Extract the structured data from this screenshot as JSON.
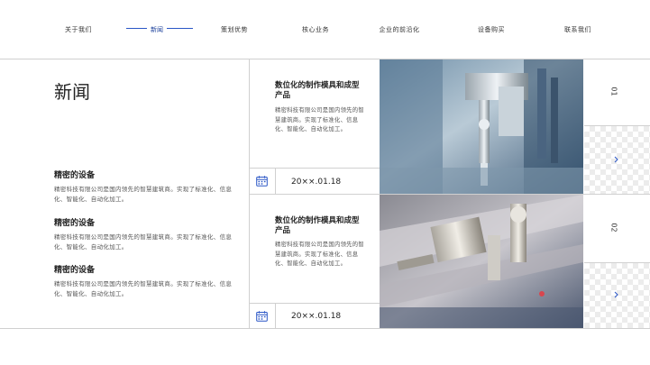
{
  "nav": {
    "items": [
      "关于我们",
      "新闻",
      "策划优势",
      "核心业务",
      "企业的前沿化",
      "设备购买",
      "联系我们"
    ],
    "active_index": 1
  },
  "page_title": "新闻",
  "features": [
    {
      "title": "精密的设备",
      "desc": "精密科技有限公司是国内领先的智慧建筑商。实现了标准化、信息化、智能化、自动化加工。"
    },
    {
      "title": "精密的设备",
      "desc": "精密科技有限公司是国内领先的智慧建筑商。实现了标准化、信息化、智能化、自动化加工。"
    },
    {
      "title": "精密的设备",
      "desc": "精密科技有限公司是国内领先的智慧建筑商。实现了标准化、信息化、智能化、自动化加工。"
    }
  ],
  "news": [
    {
      "title": "数位化的制作模具和成型产品",
      "desc": "精密科技有限公司是国内领先的智慧建筑商。实现了标准化、信息化、智能化、自动化加工。",
      "date": "20××.01.18",
      "number": "01",
      "icon": "calendar-icon",
      "photo": "machine-photo"
    },
    {
      "title": "数位化的制作模具和成型产品",
      "desc": "精密科技有限公司是国内领先的智慧建筑商。实现了标准化、信息化、智能化、自动化加工。",
      "date": "20××.01.18",
      "number": "02",
      "icon": "calendar-icon",
      "photo": "machine-photo"
    }
  ],
  "colors": {
    "accent": "#2a56c6",
    "line": "#d0d0d0",
    "text": "#222222"
  }
}
